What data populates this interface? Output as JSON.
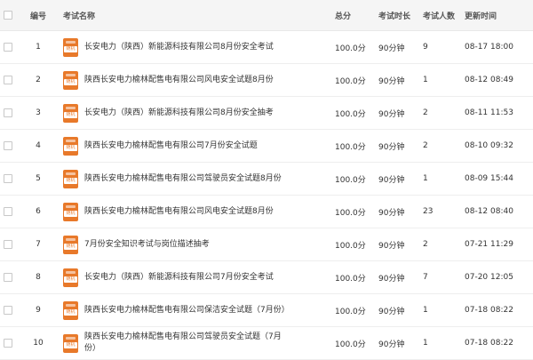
{
  "header": {
    "col_index": "编号",
    "col_name": "考试名称",
    "col_score": "总分",
    "col_duration": "考试时长",
    "col_count": "考试人数",
    "col_updated": "更新时间"
  },
  "badge_label": "随机",
  "badge_icon": "exam-paper-icon",
  "colors": {
    "badge": "#e8792a",
    "header_bg": "#f5f5f5"
  },
  "rows": [
    {
      "index": "1",
      "name": "长安电力（陕西）新能源科技有限公司8月份安全考试",
      "score": "100.0分",
      "duration": "90分钟",
      "count": "9",
      "updated": "08-17 18:00"
    },
    {
      "index": "2",
      "name": "陕西长安电力榆林配售电有限公司风电安全试题8月份",
      "score": "100.0分",
      "duration": "90分钟",
      "count": "1",
      "updated": "08-12 08:49"
    },
    {
      "index": "3",
      "name": "长安电力（陕西）新能源科技有限公司8月份安全抽考",
      "score": "100.0分",
      "duration": "90分钟",
      "count": "2",
      "updated": "08-11 11:53"
    },
    {
      "index": "4",
      "name": "陕西长安电力榆林配售电有限公司7月份安全试题",
      "score": "100.0分",
      "duration": "90分钟",
      "count": "2",
      "updated": "08-10 09:32"
    },
    {
      "index": "5",
      "name": "陕西长安电力榆林配售电有限公司驾驶员安全试题8月份",
      "score": "100.0分",
      "duration": "90分钟",
      "count": "1",
      "updated": "08-09 15:44"
    },
    {
      "index": "6",
      "name": "陕西长安电力榆林配售电有限公司风电安全试题8月份",
      "score": "100.0分",
      "duration": "90分钟",
      "count": "23",
      "updated": "08-12 08:40"
    },
    {
      "index": "7",
      "name": "7月份安全知识考试与岗位描述抽考",
      "score": "100.0分",
      "duration": "90分钟",
      "count": "2",
      "updated": "07-21 11:29"
    },
    {
      "index": "8",
      "name": "长安电力（陕西）新能源科技有限公司7月份安全考试",
      "score": "100.0分",
      "duration": "90分钟",
      "count": "7",
      "updated": "07-20 12:05"
    },
    {
      "index": "9",
      "name": "陕西长安电力榆林配售电有限公司保洁安全试题（7月份）",
      "score": "100.0分",
      "duration": "90分钟",
      "count": "1",
      "updated": "07-18 08:22"
    },
    {
      "index": "10",
      "name": "陕西长安电力榆林配售电有限公司驾驶员安全试题（7月份）",
      "score": "100.0分",
      "duration": "90分钟",
      "count": "1",
      "updated": "07-18 08:22"
    }
  ]
}
